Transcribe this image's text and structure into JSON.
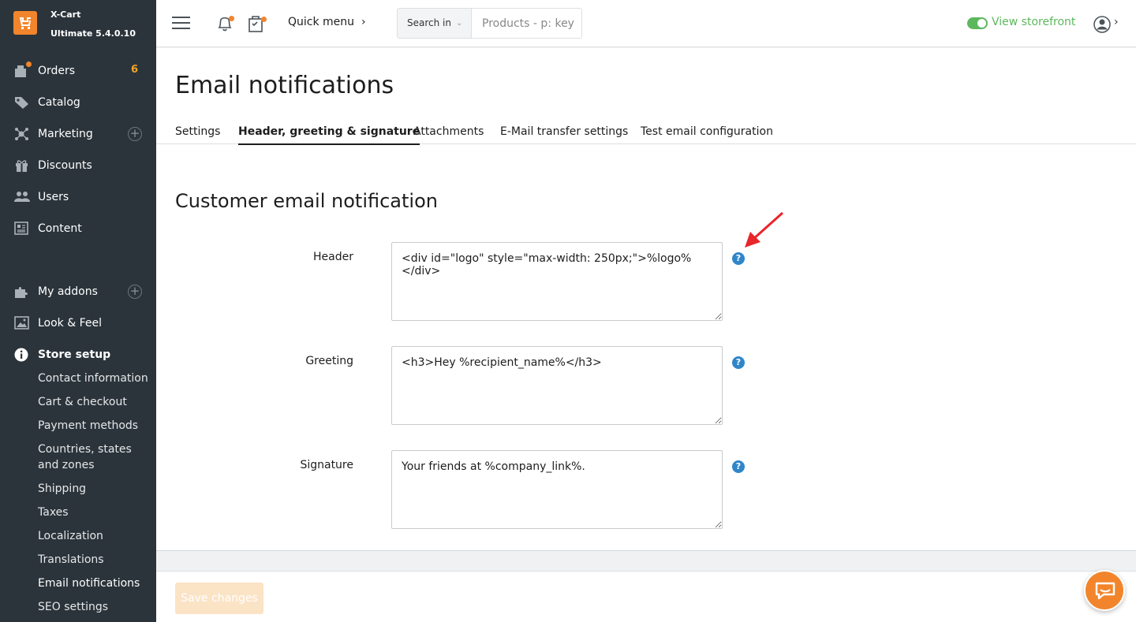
{
  "brand": {
    "name": "X-Cart",
    "version": "Ultimate 5.4.0.10"
  },
  "sidebar": {
    "items": [
      {
        "label": "Orders",
        "icon": "orders-icon",
        "count": "6"
      },
      {
        "label": "Catalog",
        "icon": "tag-icon"
      },
      {
        "label": "Marketing",
        "icon": "marketing-icon"
      },
      {
        "label": "Discounts",
        "icon": "gift-icon"
      },
      {
        "label": "Users",
        "icon": "users-icon"
      },
      {
        "label": "Content",
        "icon": "content-icon"
      },
      {
        "label": "My addons",
        "icon": "puzzle-icon"
      },
      {
        "label": "Look & Feel",
        "icon": "image-icon"
      },
      {
        "label": "Store setup",
        "icon": "info-icon"
      }
    ],
    "store_setup_sub": [
      "Contact information",
      "Cart & checkout",
      "Payment methods",
      "Countries, states and zones",
      "Shipping",
      "Taxes",
      "Localization",
      "Translations",
      "Email notifications",
      "SEO settings"
    ]
  },
  "topbar": {
    "quick_menu": "Quick menu",
    "search_in": "Search in",
    "search_placeholder": "Products - p: key",
    "view_storefront": "View storefront"
  },
  "page": {
    "title": "Email notifications",
    "tabs": [
      "Settings",
      "Header, greeting & signature",
      "Attachments",
      "E-Mail transfer settings",
      "Test email configuration"
    ],
    "active_tab": "Header, greeting & signature",
    "section_title": "Customer email notification",
    "fields": [
      {
        "label": "Header",
        "value": "<div id=\"logo\" style=\"max-width: 250px;\">%logo%</div>"
      },
      {
        "label": "Greeting",
        "value": "<h3>Hey %recipient_name%</h3>"
      },
      {
        "label": "Signature",
        "value": "Your friends at %company_link%."
      }
    ],
    "help_glyph": "?"
  },
  "footer": {
    "save_label": "Save changes"
  },
  "colors": {
    "sidebar_bg": "#2b343b",
    "accent": "#f2852c",
    "link_green": "#5cb85c",
    "help_blue": "#2f87c9",
    "arrow_red": "#e8262b"
  }
}
